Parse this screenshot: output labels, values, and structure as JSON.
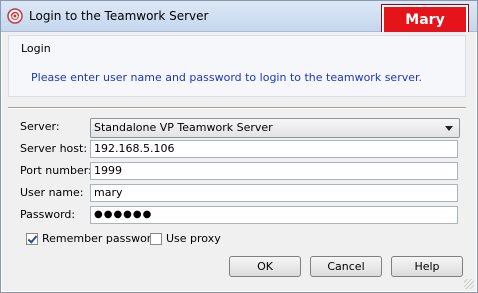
{
  "window": {
    "title": "Login to the Teamwork Server",
    "user_badge": "Mary"
  },
  "header": {
    "group_title": "Login",
    "message": "Please enter user name and password to login to the teamwork server."
  },
  "form": {
    "server_label": "Server:",
    "server_value": "Standalone VP Teamwork Server",
    "host_label": "Server host:",
    "host_value": "192.168.5.106",
    "port_label": "Port number:",
    "port_value": "1999",
    "user_label": "User name:",
    "user_value": "mary",
    "password_label": "Password:",
    "password_value": "●●●●●●"
  },
  "options": {
    "remember_label": "Remember password",
    "remember_checked": true,
    "proxy_label": "Use proxy",
    "proxy_checked": false
  },
  "buttons": {
    "ok": "OK",
    "cancel": "Cancel",
    "help": "Help"
  },
  "icons": {
    "app": "teamwork-app-icon",
    "dropdown": "chevron-down-icon"
  }
}
